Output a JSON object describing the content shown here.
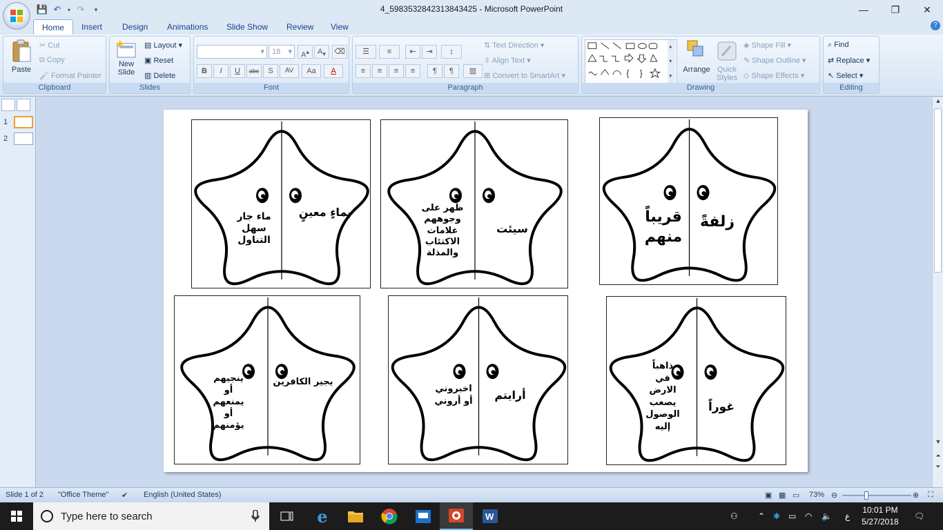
{
  "window": {
    "title": "4_5983532842313843425 - Microsoft PowerPoint",
    "minimize_icon": "—",
    "restore_icon": "❐",
    "close_icon": "✕"
  },
  "tabs": [
    "Home",
    "Insert",
    "Design",
    "Animations",
    "Slide Show",
    "Review",
    "View"
  ],
  "ribbon": {
    "clipboard": {
      "label": "Clipboard",
      "paste": "Paste",
      "cut": "Cut",
      "copy": "Copy",
      "format_painter": "Format Painter"
    },
    "slides": {
      "label": "Slides",
      "new_slide_line1": "New",
      "new_slide_line2": "Slide",
      "layout": "Layout",
      "reset": "Reset",
      "delete": "Delete"
    },
    "font": {
      "label": "Font",
      "size": "18",
      "bold": "B",
      "italic": "I",
      "underline": "U",
      "strike": "abc",
      "shadow": "S",
      "spacing": "AV",
      "case": "Aa",
      "color": "A",
      "grow": "A",
      "shrink": "A"
    },
    "paragraph": {
      "label": "Paragraph",
      "text_direction": "Text Direction",
      "align_text": "Align Text",
      "convert_smartart": "Convert to SmartArt"
    },
    "drawing": {
      "label": "Drawing",
      "arrange": "Arrange",
      "quick_styles_line1": "Quick",
      "quick_styles_line2": "Styles",
      "shape_fill": "Shape Fill",
      "shape_outline": "Shape Outline",
      "shape_effects": "Shape Effects"
    },
    "editing": {
      "label": "Editing",
      "find": "Find",
      "replace": "Replace",
      "select": "Select"
    }
  },
  "slide_pane": {
    "items": [
      {
        "num": "1"
      },
      {
        "num": "2"
      }
    ]
  },
  "cards": [
    {
      "right": "بماءٍ معينٍ",
      "left": [
        "ماء جار",
        "سهل",
        "التناول"
      ]
    },
    {
      "right": "سيئت",
      "left": [
        "ظهر على",
        "وجوههم",
        "علامات",
        "الاكتئاب",
        "والمذلة"
      ]
    },
    {
      "right": "زلفةً",
      "left": [
        "قريباً",
        "منهم"
      ]
    },
    {
      "right": "يجير الكافرين",
      "left": [
        "ينجيهم",
        "أو",
        "يمنعهم",
        "أو",
        "يؤمنهم"
      ]
    },
    {
      "right": "أرايتم",
      "left": [
        "اخبروني",
        "أو أروني"
      ]
    },
    {
      "right": "غوراً",
      "left": [
        "ذاهباً",
        "في",
        "الارض",
        "يصعب",
        "الوصول",
        "إليه"
      ]
    }
  ],
  "status": {
    "slide": "Slide 1 of 2",
    "theme": "\"Office Theme\"",
    "language": "English (United States)",
    "zoom": "73%"
  },
  "taskbar": {
    "search_placeholder": "Type here to search",
    "lang": "ع",
    "time": "10:01 PM",
    "date": "5/27/2018"
  }
}
